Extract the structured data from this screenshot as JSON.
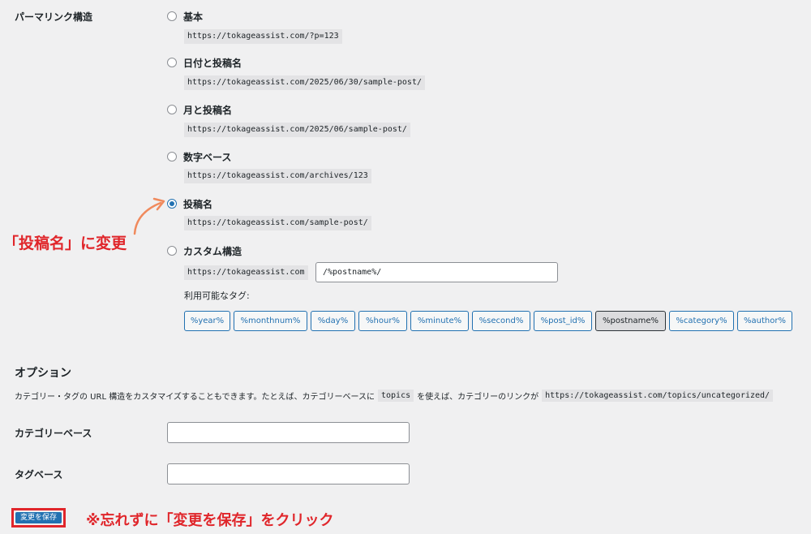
{
  "permalink": {
    "section_label": "パーマリンク構造",
    "options": [
      {
        "label": "基本",
        "example": "https://tokageassist.com/?p=123",
        "checked": false
      },
      {
        "label": "日付と投稿名",
        "example": "https://tokageassist.com/2025/06/30/sample-post/",
        "checked": false
      },
      {
        "label": "月と投稿名",
        "example": "https://tokageassist.com/2025/06/sample-post/",
        "checked": false
      },
      {
        "label": "数字ベース",
        "example": "https://tokageassist.com/archives/123",
        "checked": false
      },
      {
        "label": "投稿名",
        "example": "https://tokageassist.com/sample-post/",
        "checked": true
      }
    ],
    "custom": {
      "label": "カスタム構造",
      "base_url": "https://tokageassist.com",
      "value": "/%postname%/"
    },
    "available_tags_label": "利用可能なタグ:",
    "tags": [
      "%year%",
      "%monthnum%",
      "%day%",
      "%hour%",
      "%minute%",
      "%second%",
      "%post_id%",
      "%postname%",
      "%category%",
      "%author%"
    ],
    "active_tag": "%postname%"
  },
  "options_section": {
    "heading": "オプション",
    "description_part1": "カテゴリー・タグの URL 構造をカスタマイズすることもできます。たとえば、カテゴリーベースに",
    "description_code": "topics",
    "description_part2": "を使えば、カテゴリーのリンクが",
    "description_url": "https://tokageassist.com/topics/uncategorized/",
    "category_base_label": "カテゴリーベース",
    "category_base_value": "",
    "tag_base_label": "タグベース",
    "tag_base_value": ""
  },
  "save_button_label": "変更を保存",
  "annotations": {
    "change_note": "「投稿名」に変更",
    "save_note": "※忘れずに「変更を保存」をクリック",
    "color": "#e0262b",
    "arrow_color": "#f08a5d"
  },
  "colors": {
    "accent": "#2271b1",
    "background": "#f0f0f1"
  }
}
